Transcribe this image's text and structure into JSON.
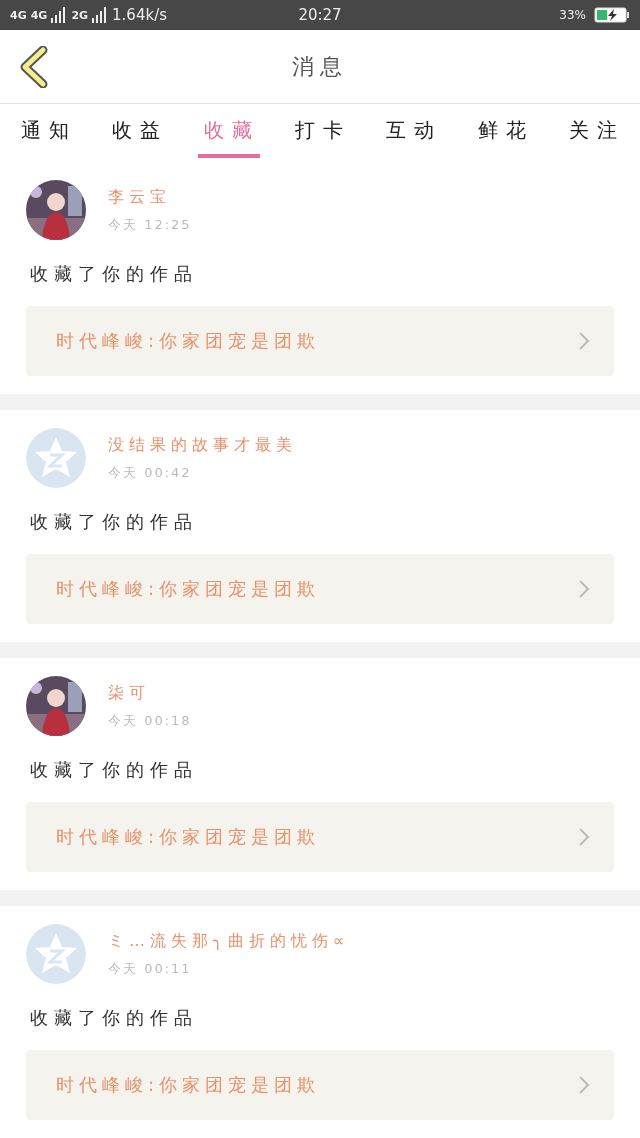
{
  "status_bar": {
    "networks": [
      "4G",
      "4G",
      "2G"
    ],
    "speed": "1.64k/s",
    "time": "20:27",
    "battery": "33%"
  },
  "header": {
    "title": "消息"
  },
  "tabs": [
    {
      "label": "通知",
      "selected": false
    },
    {
      "label": "收益",
      "selected": false
    },
    {
      "label": "收藏",
      "selected": true
    },
    {
      "label": "打卡",
      "selected": false
    },
    {
      "label": "互动",
      "selected": false
    },
    {
      "label": "鲜花",
      "selected": false
    },
    {
      "label": "关注",
      "selected": false
    }
  ],
  "messages": [
    {
      "name": "李云宝",
      "time": "今天 12:25",
      "action": "收藏了你的作品",
      "work": "时代峰峻:你家团宠是团欺"
    },
    {
      "avatar": {
        "kind": "default"
      },
      "name": "没结果的故事才最美",
      "time": "今天 00:42",
      "action": "收藏了你的作品",
      "work": "时代峰峻:你家团宠是团欺"
    },
    {
      "name": "柒可",
      "time": "今天 00:18",
      "action": "收藏了你的作品",
      "work": "时代峰峻:你家团宠是团欺"
    },
    {
      "avatar": {
        "kind": "default"
      },
      "name": "ミ…流失那╮曲折的忧伤∝",
      "time": "今天 00:11",
      "action": "收藏了你的作品",
      "work": "时代峰峻:你家团宠是团欺"
    }
  ]
}
